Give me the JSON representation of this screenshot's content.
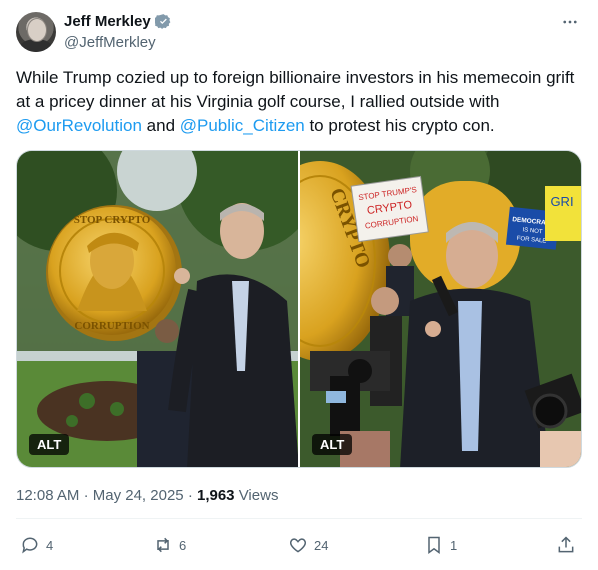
{
  "author": {
    "name": "Jeff Merkley",
    "handle": "@JeffMerkley"
  },
  "tweet": {
    "text_part1": "While Trump cozied up to foreign billionaire investors in his memecoin grift at a pricey dinner at his Virginia golf course, I rallied outside with ",
    "mention1": "@OurRevolution",
    "text_part2": " and ",
    "mention2": "@Public_Citizen",
    "text_part3": " to protest his crypto con."
  },
  "media": {
    "image1_alt_badge": "ALT",
    "image2_alt_badge": "ALT",
    "coin_text_top": "STOP CRYPTO",
    "coin_text_bottom": "CORRUPTION",
    "sign_text": "STOP TRUMP'S CRYPTO CORRUPTION",
    "sign2_text": "DEMOCRACY IS NOT FOR SALE"
  },
  "meta": {
    "time": "12:08 AM",
    "sep": "·",
    "date": "May 24, 2025",
    "views_count": "1,963",
    "views_label": "Views"
  },
  "actions": {
    "replies": "4",
    "reposts": "6",
    "likes": "24",
    "bookmarks": "1"
  },
  "colors": {
    "accent": "#1d9bf0",
    "secondary_text": "#536471"
  }
}
